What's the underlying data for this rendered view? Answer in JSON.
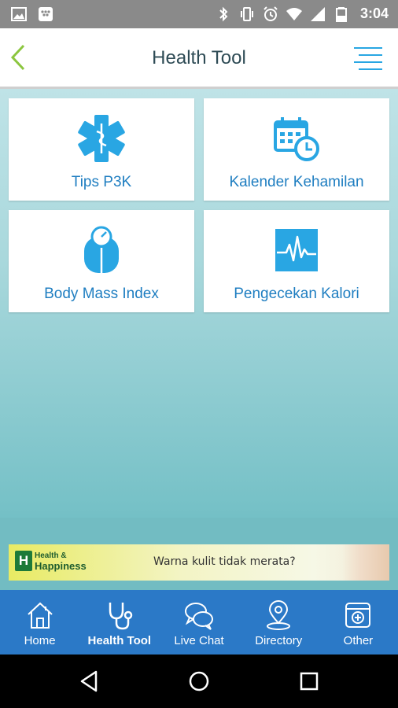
{
  "status_bar": {
    "time": "3:04"
  },
  "header": {
    "title": "Health Tool"
  },
  "tools": [
    {
      "label": "Tips P3K",
      "icon": "medical-star-icon"
    },
    {
      "label": "Kalender Kehamilan",
      "icon": "calendar-clock-icon"
    },
    {
      "label": "Body Mass Index",
      "icon": "scale-icon"
    },
    {
      "label": "Pengecekan Kalori",
      "icon": "heartbeat-icon"
    }
  ],
  "ad": {
    "brand_mark": "H",
    "brand_line1": "Health &",
    "brand_line2": "Happiness",
    "slogan": "Warna kulit tidak merata?"
  },
  "bottom_nav": [
    {
      "label": "Home",
      "icon": "house-icon",
      "active": false
    },
    {
      "label": "Health Tool",
      "icon": "stethoscope-icon",
      "active": true
    },
    {
      "label": "Live Chat",
      "icon": "chat-bubbles-icon",
      "active": false
    },
    {
      "label": "Directory",
      "icon": "map-pin-icon",
      "active": false
    },
    {
      "label": "Other",
      "icon": "plus-box-icon",
      "active": false
    }
  ],
  "colors": {
    "accent_blue": "#1f7ec1",
    "icon_blue": "#29a6e3",
    "nav_bg": "#2b79c7",
    "back_green": "#8cc63f"
  }
}
